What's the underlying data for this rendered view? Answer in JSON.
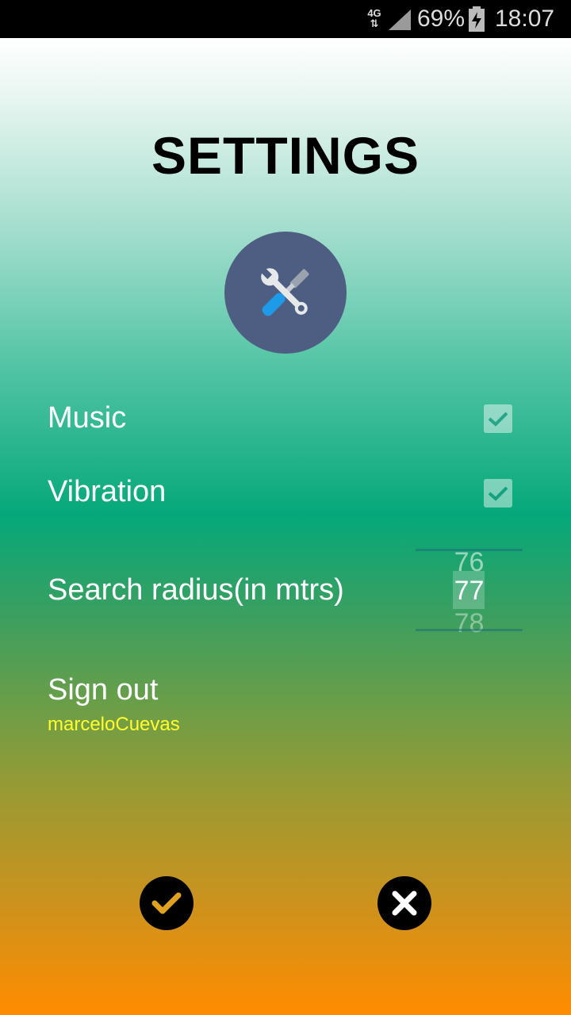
{
  "status_bar": {
    "network_top": "4G",
    "network_bottom": "⇅",
    "battery": "69%",
    "time": "18:07",
    "icons": [
      "signal-icon",
      "battery-charging-icon"
    ]
  },
  "page": {
    "title": "SETTINGS",
    "header_icon": "tools-icon"
  },
  "settings": {
    "music": {
      "label": "Music",
      "checked": true
    },
    "vibration": {
      "label": "Vibration",
      "checked": true
    },
    "search_radius": {
      "label": "Search radius(in mtrs)",
      "prev": "76",
      "value": "77",
      "next": "78"
    },
    "sign_out": {
      "label": "Sign out",
      "username": "marceloCuevas"
    }
  },
  "actions": {
    "confirm_icon": "check-icon",
    "cancel_icon": "close-icon",
    "confirm_color": "#e0a21e",
    "cancel_color": "#ffffff"
  },
  "colors": {
    "icon_circle": "#4e5e82",
    "username": "#ffff2b",
    "gradient_top": "#ffffff",
    "gradient_mid": "#05a87a",
    "gradient_bottom": "#ff8c00"
  }
}
